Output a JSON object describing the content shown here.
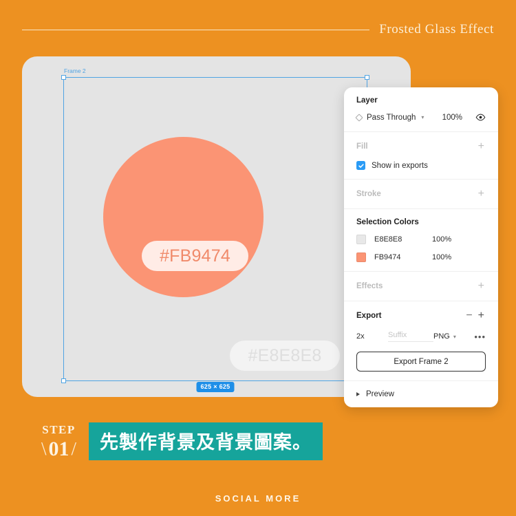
{
  "theme": {
    "background": "#ED9121",
    "canvas": "#E4E4E4",
    "accent_salmon": "#FB9474",
    "accent_teal": "#16A49B",
    "selection_blue": "#4FA3E3",
    "cream": "#FCEFD9"
  },
  "header": {
    "title": "Frosted Glass Effect"
  },
  "canvas": {
    "frame_label": "Frame 2",
    "size_badge": "625 × 625",
    "pill_primary": "#FB9474",
    "pill_secondary": "#E8E8E8"
  },
  "panel": {
    "layer": {
      "title": "Layer",
      "blend_mode": "Pass Through",
      "opacity": "100%",
      "chevron": "chevron-down-icon",
      "visibility_icon": "eye-icon"
    },
    "fill": {
      "title": "Fill",
      "add": "+",
      "show_in_exports": "Show in exports",
      "checked": true
    },
    "stroke": {
      "title": "Stroke",
      "add": "+"
    },
    "selection_colors": {
      "title": "Selection Colors",
      "rows": [
        {
          "swatch": "#E8E8E8",
          "hex": "E8E8E8",
          "opacity": "100%"
        },
        {
          "swatch": "#FB9474",
          "hex": "FB9474",
          "opacity": "100%"
        }
      ]
    },
    "effects": {
      "title": "Effects",
      "add": "+"
    },
    "export": {
      "title": "Export",
      "minus": "−",
      "plus": "+",
      "scale": "2x",
      "suffix_placeholder": "Suffix",
      "format": "PNG",
      "more": "•••",
      "button_label": "Export Frame 2",
      "preview_label": "Preview"
    }
  },
  "step": {
    "word": "STEP",
    "number": "01",
    "slash_left": "\\",
    "slash_right": "/",
    "text": "先製作背景及背景圖案。"
  },
  "footer": {
    "brand": "SOCIAL MORE"
  }
}
